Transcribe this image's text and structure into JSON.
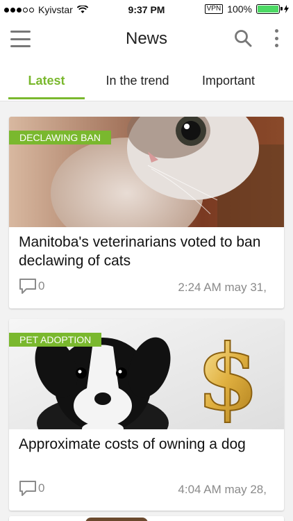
{
  "status_bar": {
    "carrier": "Kyivstar",
    "time": "9:37 PM",
    "vpn": "VPN",
    "battery": "100%"
  },
  "header": {
    "title": "News"
  },
  "tabs": [
    {
      "label": "Latest",
      "active": true
    },
    {
      "label": "In the trend",
      "active": false
    },
    {
      "label": "Important",
      "active": false
    }
  ],
  "articles": [
    {
      "category": "DECLAWING BAN",
      "title": "Manitoba's veterinarians voted to ban declawing of cats",
      "comments": "0",
      "timestamp": "2:24 AM may 31,"
    },
    {
      "category": "PET ADOPTION",
      "title": "Approximate costs of owning a dog",
      "comments": "0",
      "timestamp": "4:04 AM may 28,"
    }
  ],
  "colors": {
    "accent": "#7ab82e",
    "muted_text": "#8a8a8a",
    "icon": "#777777"
  }
}
